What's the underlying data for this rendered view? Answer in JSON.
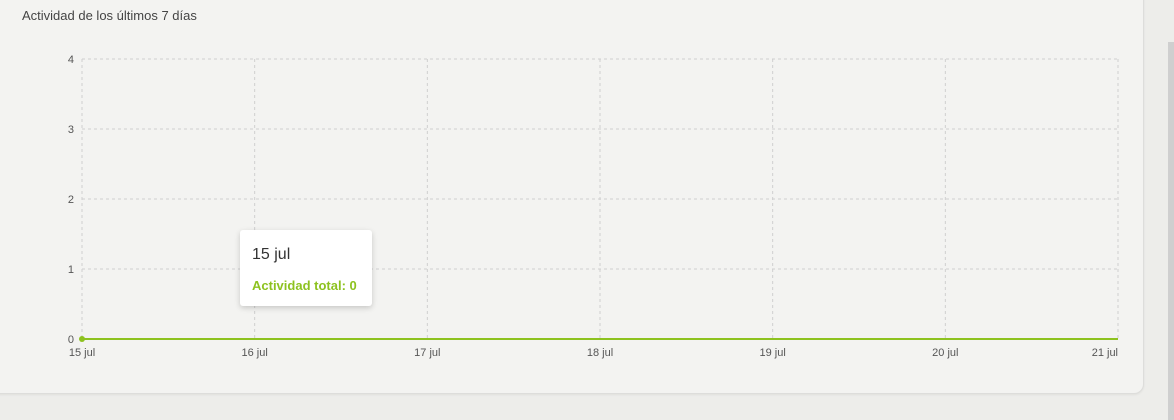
{
  "card": {
    "subtitle": "Actividad de los últimos 7 días"
  },
  "colors": {
    "accent": "#8dc21f",
    "grid": "#cfcfcf",
    "axis_text": "#555555"
  },
  "tooltip": {
    "date": "15 jul",
    "label": "Actividad total: 0"
  },
  "chart_data": {
    "type": "line",
    "title": "",
    "xlabel": "",
    "ylabel": "",
    "categories": [
      "15 jul",
      "16 jul",
      "17 jul",
      "18 jul",
      "19 jul",
      "20 jul",
      "21 jul"
    ],
    "series": [
      {
        "values": [
          0,
          0,
          0,
          0,
          0,
          0,
          0
        ]
      }
    ],
    "ylim": [
      0,
      4
    ],
    "yticks": [
      0,
      1,
      2,
      3,
      4
    ],
    "grid": true,
    "grid_style": "dashed",
    "highlighted_point": 0
  }
}
